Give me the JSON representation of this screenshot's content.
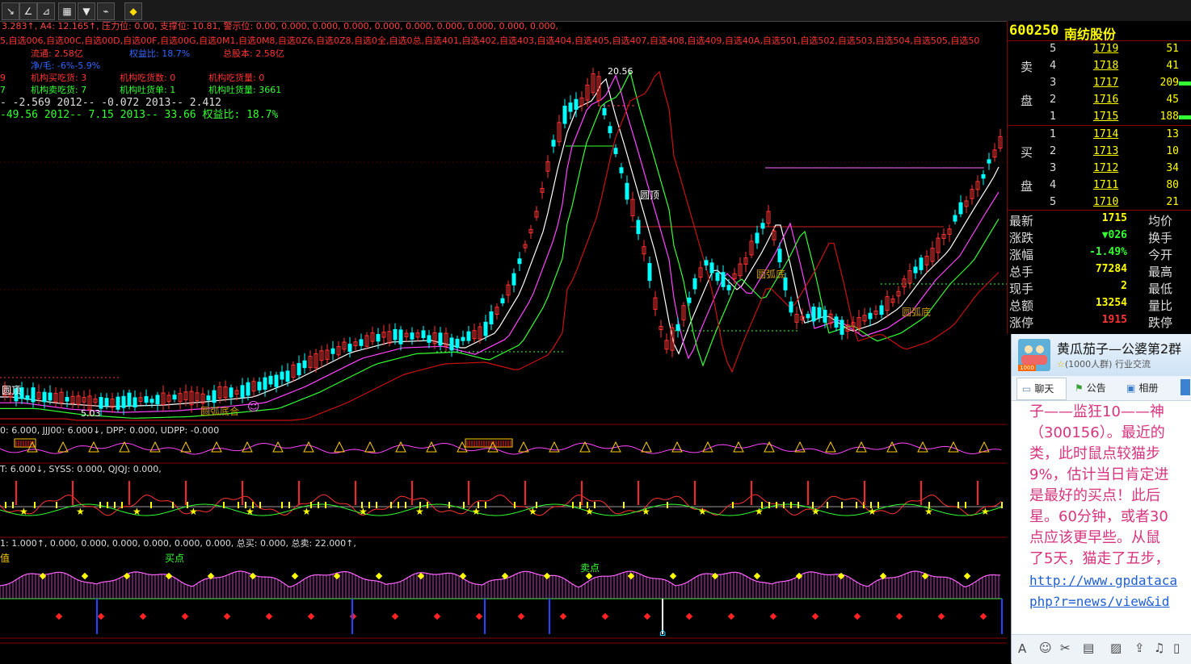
{
  "toolbar": {
    "icons": [
      "line-tool-icon",
      "angle-tool-icon",
      "fan-tool-icon",
      "grid-icon",
      "flag-icon",
      "chart-settings-icon",
      "diamond-icon"
    ],
    "glyphs": [
      "↘",
      "∠",
      "⊿",
      "▦",
      "▼",
      "⌁",
      "◆"
    ]
  },
  "chart": {
    "info_line1": "3.283↑, A4: 12.165↑, 压力位: 0.00, 支撑位: 10.81, 警示位: 0.00, 0.000, 0.000, 0.000, 0.000, 0.000, 0.000, 0.000, 0.000, 0.000,",
    "info_line2": "5,自选006,自选00C,自选00D,自选00F,自选00G,自选0M1,自选0M8,自选0Z6,自选0Z8,自选0全,自选0总,自选401,自选402,自选403,自选404,自选405,自选407,自选408,自选409,自选40A,自选501,自选502,自选503,自选504,自选505,自选50",
    "fin_liutong": "流通: 2.58亿",
    "fin_quanyi": "权益比: 18.7%",
    "fin_zongguben": "总股本: 2.58亿",
    "fin_jinmao": "净/毛: -6%-5.9%",
    "fin_row3": [
      "9",
      "机构买吃货: 3",
      "机构吃货数: 0",
      "机构吃货量: 0"
    ],
    "fin_row4": [
      "7",
      "机构卖吃货: 7",
      "机构吐货单: 1",
      "机构吐货量: 3661"
    ],
    "eps_line": "- -2.569   2012-- -0.072   2013-- 2.412",
    "pe_line": "-49.56   2012-- 7.15   2013-- 33.66   权益比: 18.7%",
    "peak_label": "20.56",
    "low_label": "5.03",
    "pattern_top": "圆顶",
    "pattern_top2": "圆顶",
    "pattern_bottom": "圆弧底",
    "pattern_bottom2": "圆弧底",
    "pattern_combo": "圆弧底合",
    "ind1_line": "0: 6.000, JJJ00: 6.000↓, DPP: 0.000, UDPP: -0.000",
    "ind2_line": "T: 6.000↓, SYSS: 0.000, QJQJ: 0.000,",
    "ind3_line": "1: 1.000↑, 0.000, 0.000, 0.000, 0.000, 0.000, 0.000, 总买: 0.000, 总卖: 22.000↑,",
    "ind3_side": "值",
    "buy_label": "买点",
    "sell_label": "卖点"
  },
  "quote": {
    "code": "600250",
    "name": "南纺股份",
    "sell_side": [
      "卖",
      "盘"
    ],
    "buy_side": [
      "买",
      "盘"
    ],
    "asks": [
      {
        "level": "5",
        "price": "1719",
        "vol": "51"
      },
      {
        "level": "4",
        "price": "1718",
        "vol": "41"
      },
      {
        "level": "3",
        "price": "1717",
        "vol": "209"
      },
      {
        "level": "2",
        "price": "1716",
        "vol": "45"
      },
      {
        "level": "1",
        "price": "1715",
        "vol": "188"
      }
    ],
    "bids": [
      {
        "level": "1",
        "price": "1714",
        "vol": "13"
      },
      {
        "level": "2",
        "price": "1713",
        "vol": "10"
      },
      {
        "level": "3",
        "price": "1712",
        "vol": "34"
      },
      {
        "level": "4",
        "price": "1711",
        "vol": "80"
      },
      {
        "level": "5",
        "price": "1710",
        "vol": "21"
      }
    ],
    "stats": [
      {
        "label": "最新",
        "value": "1715",
        "right": "均价"
      },
      {
        "label": "涨跌",
        "value": "▼026",
        "right": "换手"
      },
      {
        "label": "涨幅",
        "value": "-1.49%",
        "right": "今开"
      },
      {
        "label": "总手",
        "value": "77284",
        "right": "最高"
      },
      {
        "label": "现手",
        "value": "2",
        "right": "最低"
      },
      {
        "label": "总额",
        "value": "13254",
        "right": "量比"
      },
      {
        "label": "涨停",
        "value": "1915",
        "right": "跌停"
      }
    ]
  },
  "chat": {
    "group_name": "黄瓜茄子—公婆第2群",
    "group_meta": "(1000人群) 行业交流",
    "tabs": [
      "聊天",
      "公告",
      "相册"
    ],
    "lines": [
      "子——监狂10——神",
      "（300156）。最近的",
      "类，此时鼠点较猫步",
      "9%，估计当日肯定进",
      "是最好的买点！此后",
      "星。60分钟，或者30",
      "点应该更早些。从鼠",
      "了5天，猫走了五步，"
    ],
    "link1": "http://www.gpdataca",
    "link2": "php?r=news/view&id"
  },
  "colors": {
    "up": "#ff3333",
    "down": "#00ffff",
    "ma_white": "#ffffff",
    "ma_magenta": "#ff44ff",
    "ma_green": "#33ff33",
    "ma_red": "#cc1111",
    "quote_yellow": "#ffff00",
    "chat_text": "#d7337e"
  }
}
